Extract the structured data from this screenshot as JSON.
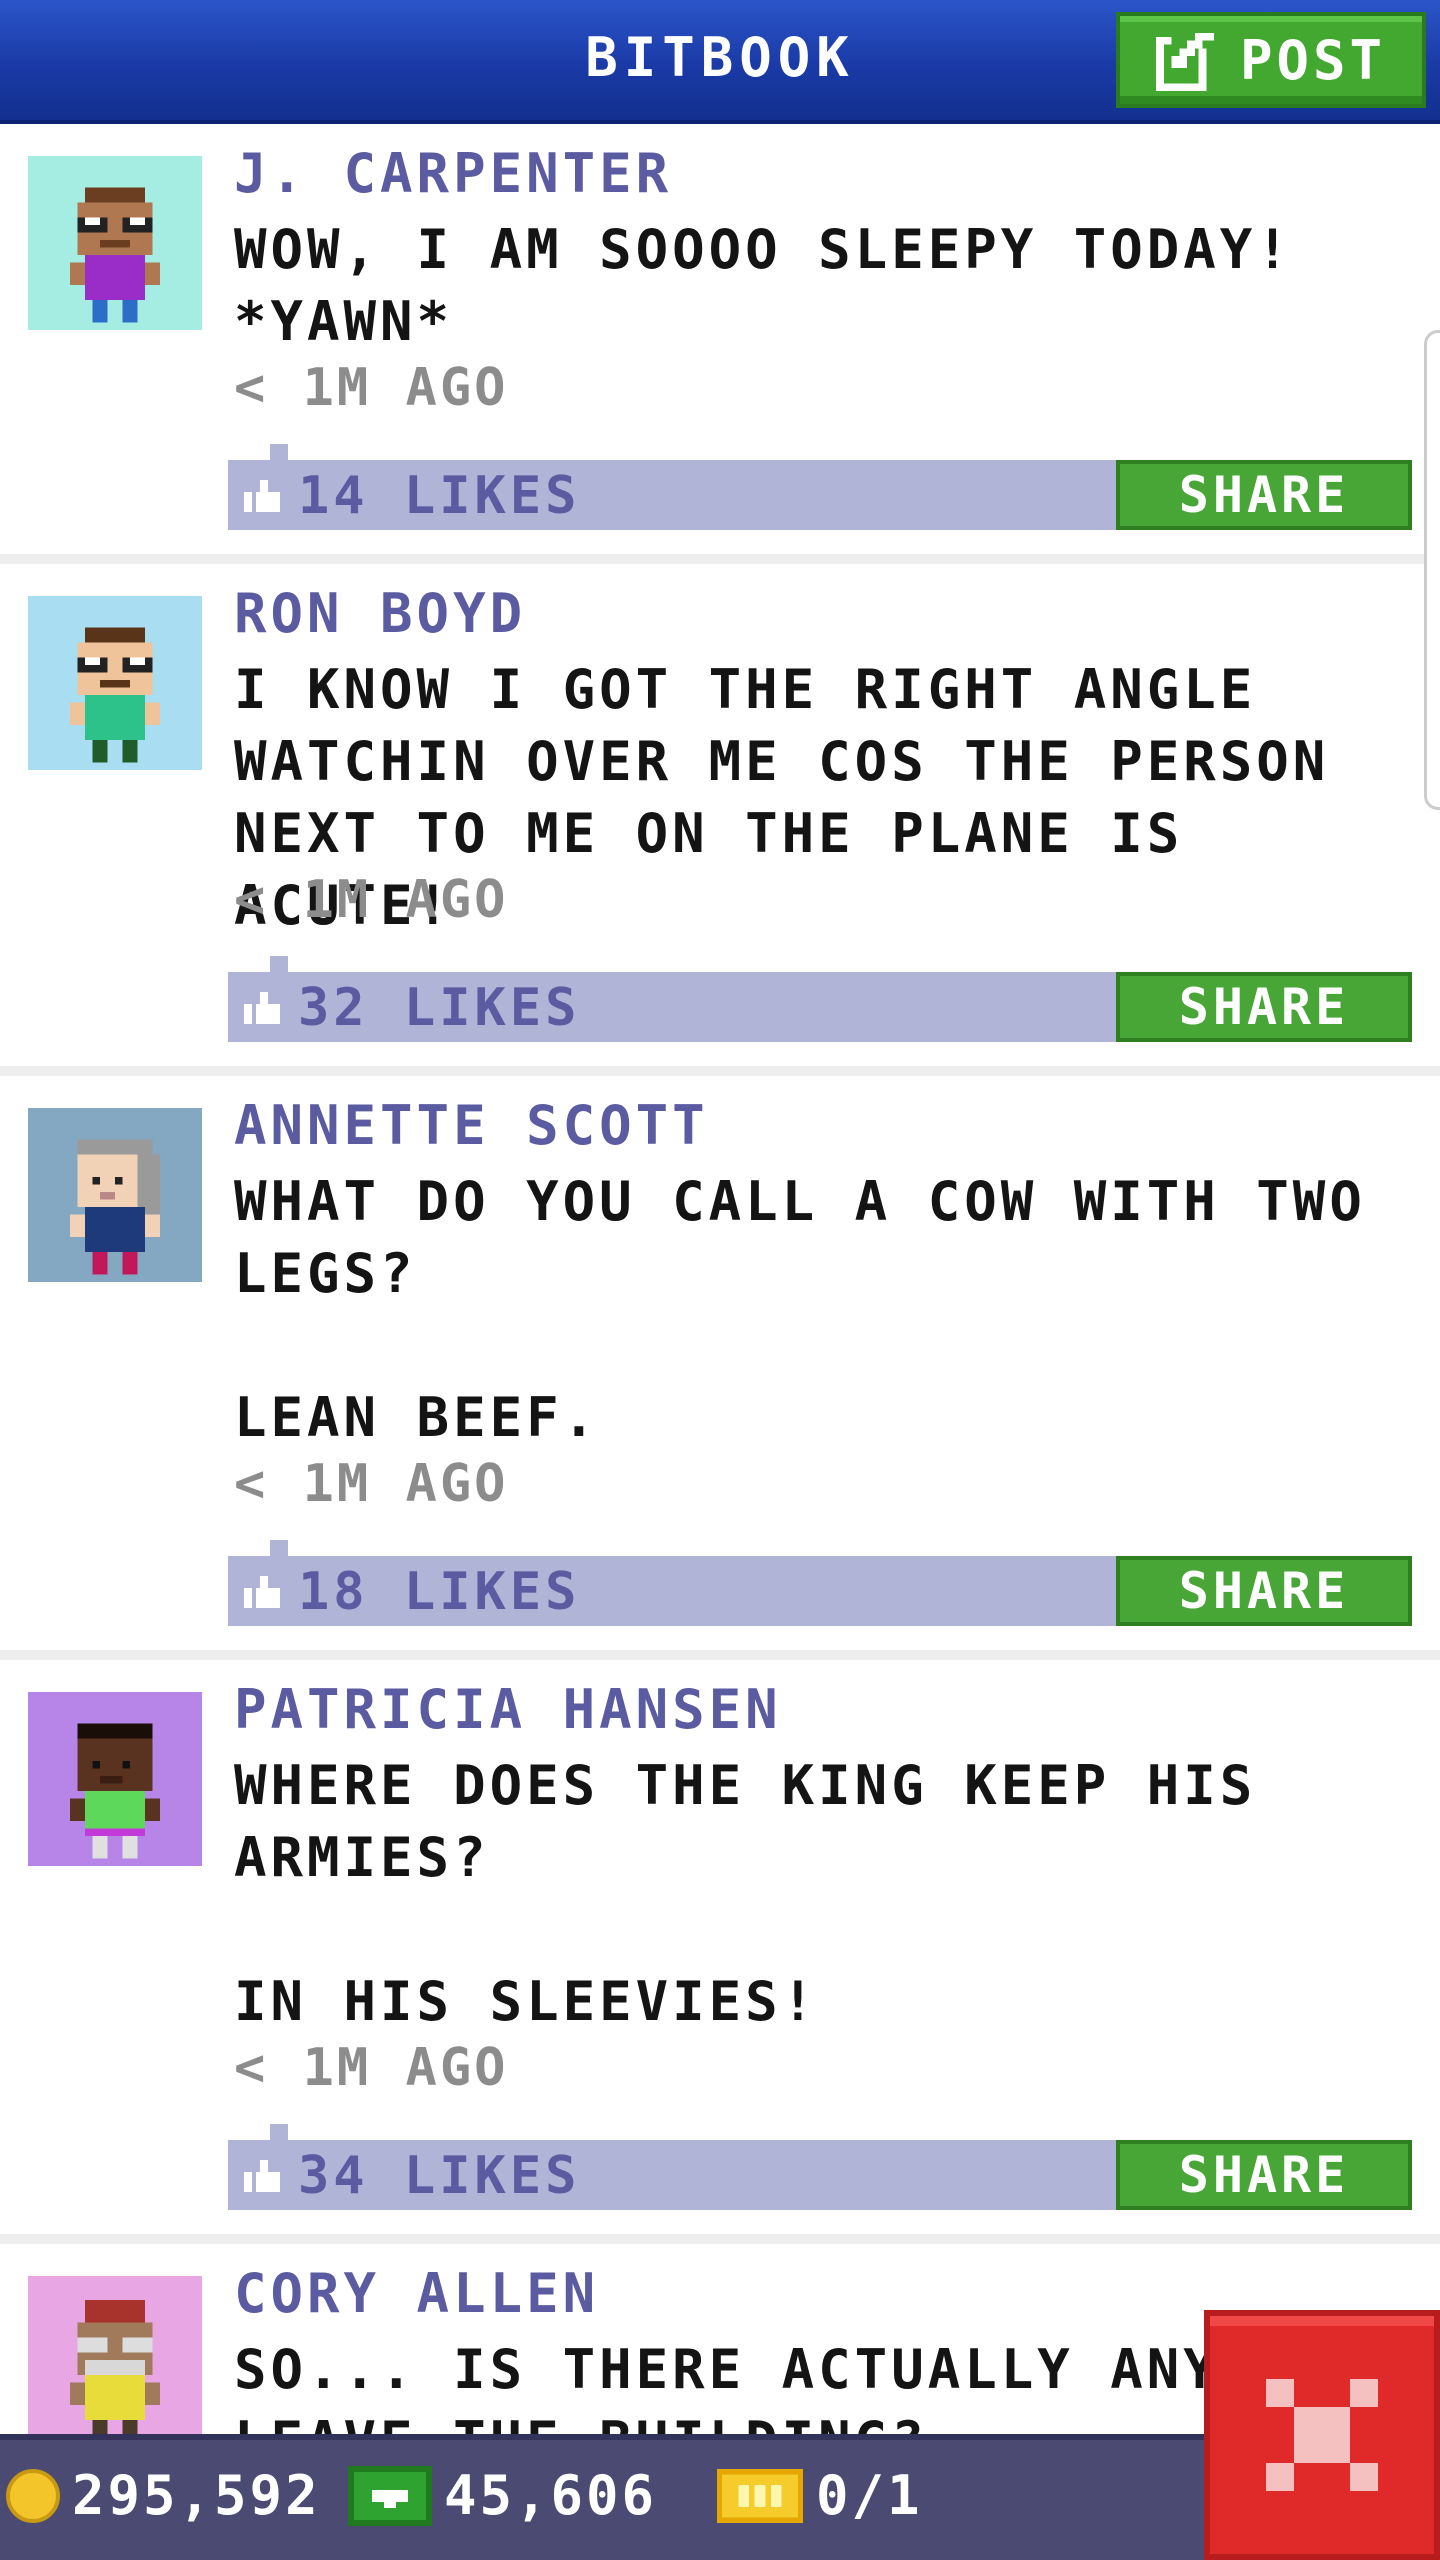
{
  "header": {
    "title": "BITBOOK",
    "post_label": "POST"
  },
  "colors": {
    "header_blue": "#1a3aa6",
    "post_green": "#42a82f",
    "name_purple": "#5a5ba0",
    "like_bar": "#b0b4d6",
    "close_red": "#e02a2a"
  },
  "posts": [
    {
      "name": "J. CARPENTER",
      "text": "WOW, I AM SOOOO SLEEPY TODAY!\n*YAWN*",
      "time": "< 1M AGO",
      "likes": "14 LIKES",
      "share_label": "SHARE",
      "avatar_bg": "#a5ede2"
    },
    {
      "name": "RON BOYD",
      "text": "I KNOW I GOT THE RIGHT ANGLE\nWATCHIN OVER ME COS THE PERSON\nNEXT TO ME ON THE PLANE IS ACUTE!",
      "time": "< 1M AGO",
      "likes": "32 LIKES",
      "share_label": "SHARE",
      "avatar_bg": "#a9def2"
    },
    {
      "name": "ANNETTE SCOTT",
      "text": "WHAT DO YOU CALL A COW WITH TWO\nLEGS?\n\nLEAN BEEF.",
      "time": "< 1M AGO",
      "likes": "18 LIKES",
      "share_label": "SHARE",
      "avatar_bg": "#85a8c2"
    },
    {
      "name": "PATRICIA HANSEN",
      "text": "WHERE DOES THE KING KEEP HIS\nARMIES?\n\nIN HIS SLEEVIES!",
      "time": "< 1M AGO",
      "likes": "34 LIKES",
      "share_label": "SHARE",
      "avatar_bg": "#b785e8"
    },
    {
      "name": "CORY ALLEN",
      "text": "SO... IS THERE ACTUALLY ANY W\nLEAVE THE BUILDING?",
      "time": "",
      "likes": "",
      "share_label": "",
      "avatar_bg": "#e9a6e4"
    }
  ],
  "bottom_bar": {
    "coins": "295,592",
    "bux": "45,606",
    "tickets": "0/1"
  },
  "icons": {
    "post": "edit-icon",
    "like": "thumbs-up-icon",
    "coin": "coin-icon",
    "bux": "bux-icon",
    "ticket": "ticket-icon",
    "close": "close-icon"
  }
}
